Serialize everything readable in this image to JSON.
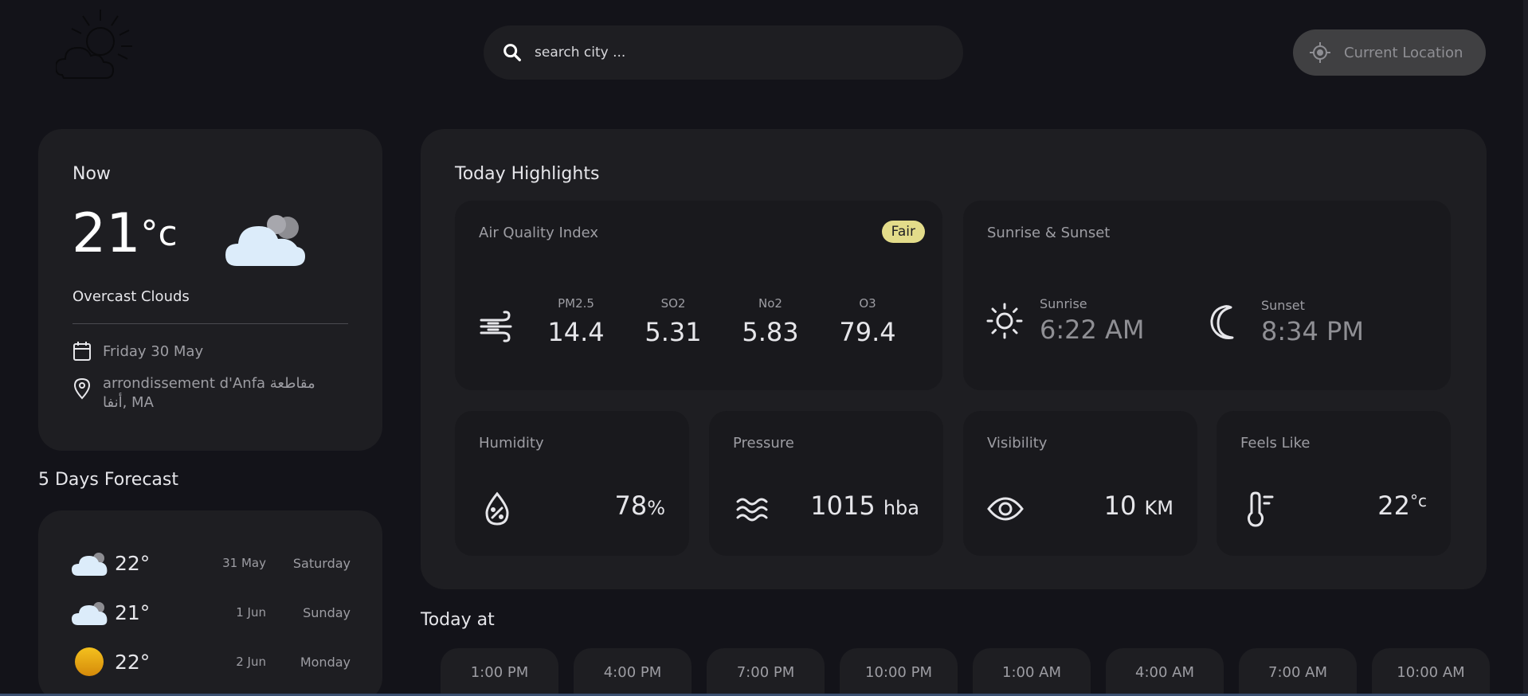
{
  "header": {
    "logo_icon": "sun-cloud-logo-icon",
    "search_placeholder": "search city ...",
    "current_location_label": "Current Location"
  },
  "now": {
    "title": "Now",
    "temp_value": "21",
    "temp_unit": "°c",
    "description": "Overcast Clouds",
    "date": "Friday 30 May",
    "location": "arrondissement d'Anfa مقاطعة أنفا, MA"
  },
  "forecast": {
    "title": "5 Days Forecast",
    "days": [
      {
        "icon": "overcast-cloud-icon",
        "temp": "22°",
        "date": "31 May",
        "day": "Saturday"
      },
      {
        "icon": "overcast-cloud-icon",
        "temp": "21°",
        "date": "1 Jun",
        "day": "Sunday"
      },
      {
        "icon": "sun-icon",
        "temp": "22°",
        "date": "2 Jun",
        "day": "Monday"
      }
    ]
  },
  "highlights": {
    "title": "Today Highlights",
    "aqi": {
      "label": "Air Quality Index",
      "badge": "Fair",
      "badge_color": "#e3dc8a",
      "pollutants": [
        {
          "name": "PM2.5",
          "value": "14.4"
        },
        {
          "name": "SO2",
          "value": "5.31"
        },
        {
          "name": "No2",
          "value": "5.83"
        },
        {
          "name": "O3",
          "value": "79.4"
        }
      ]
    },
    "sun": {
      "label": "Sunrise & Sunset",
      "sunrise_label": "Sunrise",
      "sunrise_time": "6:22 AM",
      "sunset_label": "Sunset",
      "sunset_time": "8:34 PM"
    },
    "humidity": {
      "label": "Humidity",
      "value": "78",
      "unit": "%"
    },
    "pressure": {
      "label": "Pressure",
      "value": "1015",
      "unit": "hba"
    },
    "visibility": {
      "label": "Visibility",
      "value": "10",
      "unit": "KM"
    },
    "feels_like": {
      "label": "Feels Like",
      "value": "22",
      "unit": "°c"
    }
  },
  "today_at": {
    "title": "Today at",
    "hours": [
      "1:00 PM",
      "4:00 PM",
      "7:00 PM",
      "10:00 PM",
      "1:00 AM",
      "4:00 AM",
      "7:00 AM",
      "10:00 AM"
    ]
  },
  "colors": {
    "background": "#131319",
    "card": "#1e1e22",
    "accent_badge": "#e3dc8a"
  }
}
